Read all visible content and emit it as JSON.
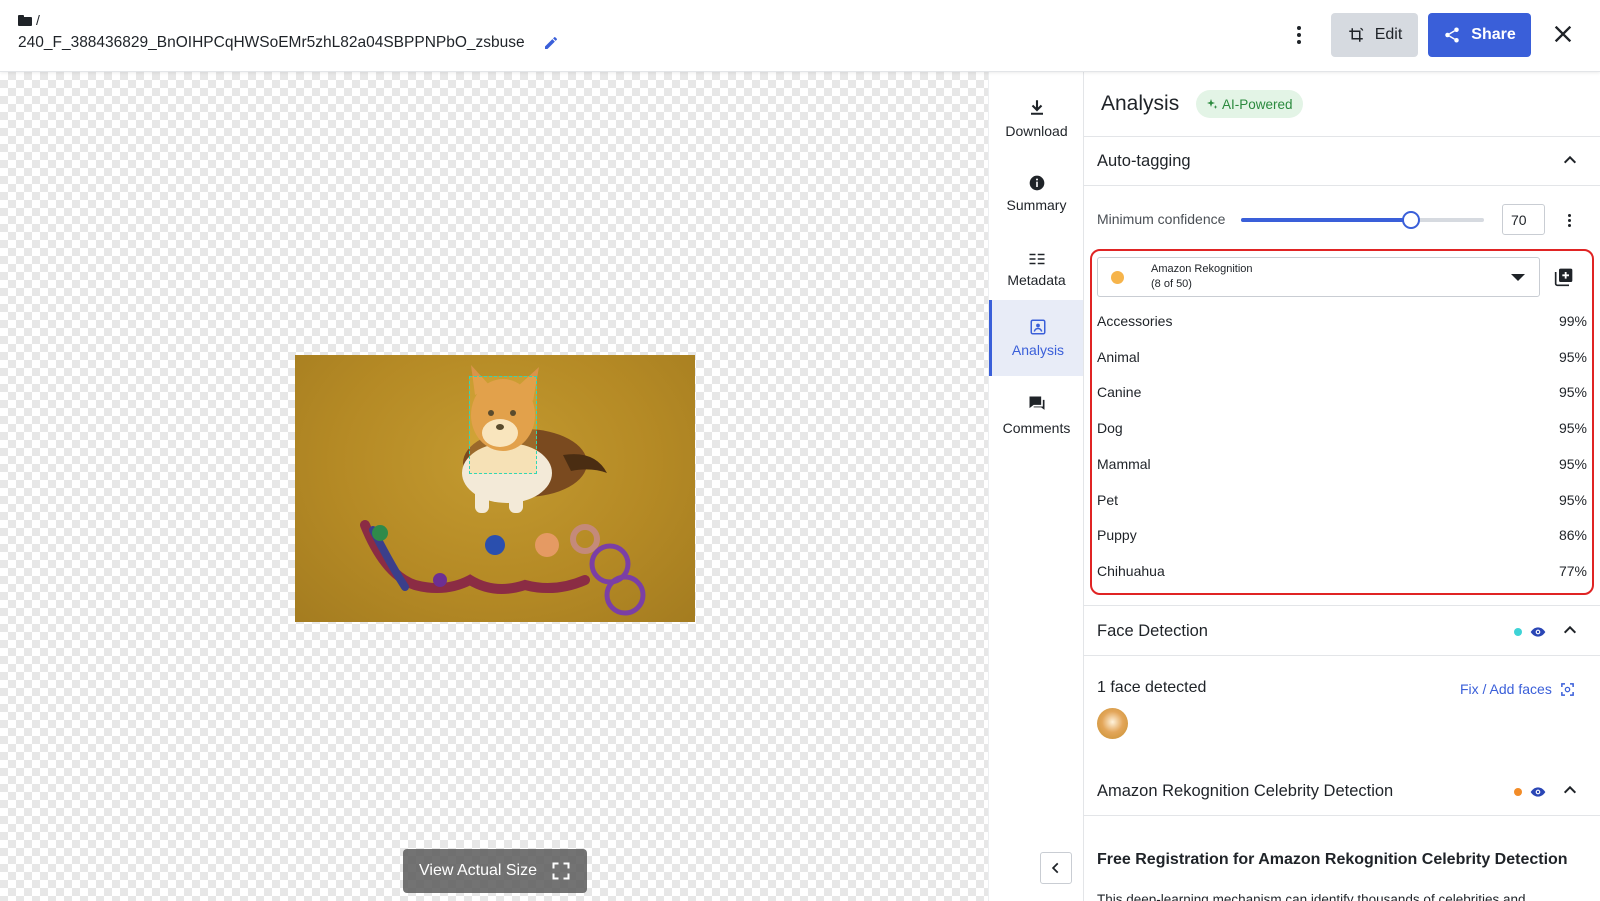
{
  "header": {
    "breadcrumb_sep": "/",
    "filename": "240_F_388436829_BnOIHPCqHWSoEMr5zhL82a04SBPPNPbO_zsbuse",
    "edit_label": "Edit",
    "share_label": "Share"
  },
  "canvas": {
    "view_actual_label": "View Actual Size"
  },
  "nav": {
    "items": [
      {
        "label": "Download",
        "icon": "download-icon"
      },
      {
        "label": "Summary",
        "icon": "info-icon"
      },
      {
        "label": "Metadata",
        "icon": "list-icon"
      },
      {
        "label": "Analysis",
        "icon": "analysis-icon",
        "active": true
      },
      {
        "label": "Comments",
        "icon": "comment-icon"
      }
    ]
  },
  "panel": {
    "title": "Analysis",
    "ai_badge": "AI-Powered",
    "auto_tagging": {
      "title": "Auto-tagging",
      "min_conf_label": "Minimum confidence",
      "min_conf_value": "70",
      "min_conf_fraction": 0.7,
      "provider": "Amazon Rekognition",
      "provider_count": "(8 of 50)",
      "provider_color": "#f6b44b",
      "tags": [
        {
          "name": "Accessories",
          "confidence": "99%"
        },
        {
          "name": "Animal",
          "confidence": "95%"
        },
        {
          "name": "Canine",
          "confidence": "95%"
        },
        {
          "name": "Dog",
          "confidence": "95%"
        },
        {
          "name": "Mammal",
          "confidence": "95%"
        },
        {
          "name": "Pet",
          "confidence": "95%"
        },
        {
          "name": "Puppy",
          "confidence": "86%"
        },
        {
          "name": "Chihuahua",
          "confidence": "77%"
        }
      ]
    },
    "face_detection": {
      "title": "Face Detection",
      "dot_color": "#3ed3d6",
      "count_text": "1 face detected",
      "fix_label": "Fix / Add faces"
    },
    "celebrity": {
      "title": "Amazon Rekognition Celebrity Detection",
      "dot_color": "#f28c28",
      "free_title": "Free Registration for Amazon Rekognition Celebrity Detection",
      "desc": "This deep-learning mechanism can identify thousands of celebrities and"
    }
  },
  "colors": {
    "accent": "#3a5fd9",
    "highlight": "#e02424"
  }
}
